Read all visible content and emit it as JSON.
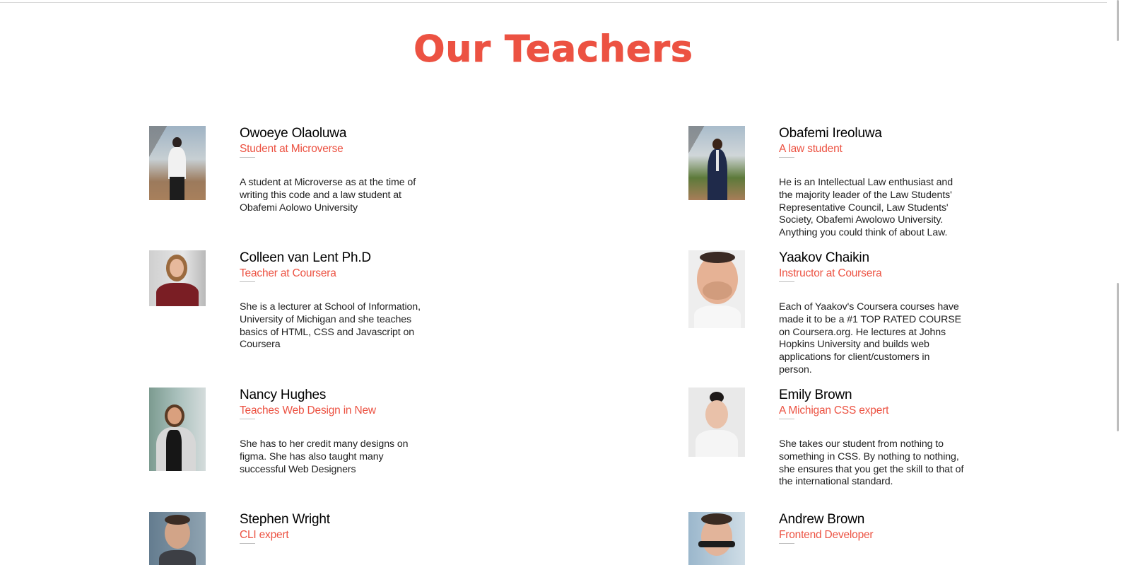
{
  "section": {
    "title": "Our Teachers"
  },
  "accent_color": "#ec5242",
  "teachers": [
    {
      "name": "Owoeye Olaoluwa",
      "role": "Student at Microverse",
      "description": "A student at Microverse as at the time of writing this code and a law student at Obafemi Aolowo University",
      "photo_icon": "person-photo"
    },
    {
      "name": "Obafemi Ireoluwa",
      "role": "A law student",
      "description": "He is an Intellectual Law enthusiast and the majority leader of the Law Students' Representative Council, Law Students' Society, Obafemi Awolowo University. Anything you could think of about Law.",
      "photo_icon": "person-photo"
    },
    {
      "name": "Colleen van Lent Ph.D",
      "role": "Teacher at Coursera",
      "description": "She is a lecturer at School of Information, University of Michigan and she teaches basics of HTML, CSS and Javascript on Coursera",
      "photo_icon": "person-photo"
    },
    {
      "name": "Yaakov Chaikin",
      "role": "Instructor at Coursera",
      "description": "Each of Yaakov's Coursera courses have made it to be a #1 TOP RATED COURSE on Coursera.org. He lectures at Johns Hopkins University and builds web applications for client/customers in person.",
      "photo_icon": "person-photo"
    },
    {
      "name": "Nancy Hughes",
      "role": "Teaches Web Design in New",
      "description": "She has to her credit many designs on figma. She has also taught many successful Web Designers",
      "photo_icon": "person-photo"
    },
    {
      "name": "Emily Brown",
      "role": "A Michigan CSS expert",
      "description": "She takes our student from nothing to something in CSS. By nothing to nothing, she ensures that you get the skill to that of the international standard.",
      "photo_icon": "person-photo"
    },
    {
      "name": "Stephen Wright",
      "role": "CLI expert",
      "description": "",
      "photo_icon": "person-photo"
    },
    {
      "name": "Andrew Brown",
      "role": "Frontend Developer",
      "description": "",
      "photo_icon": "person-photo"
    }
  ]
}
